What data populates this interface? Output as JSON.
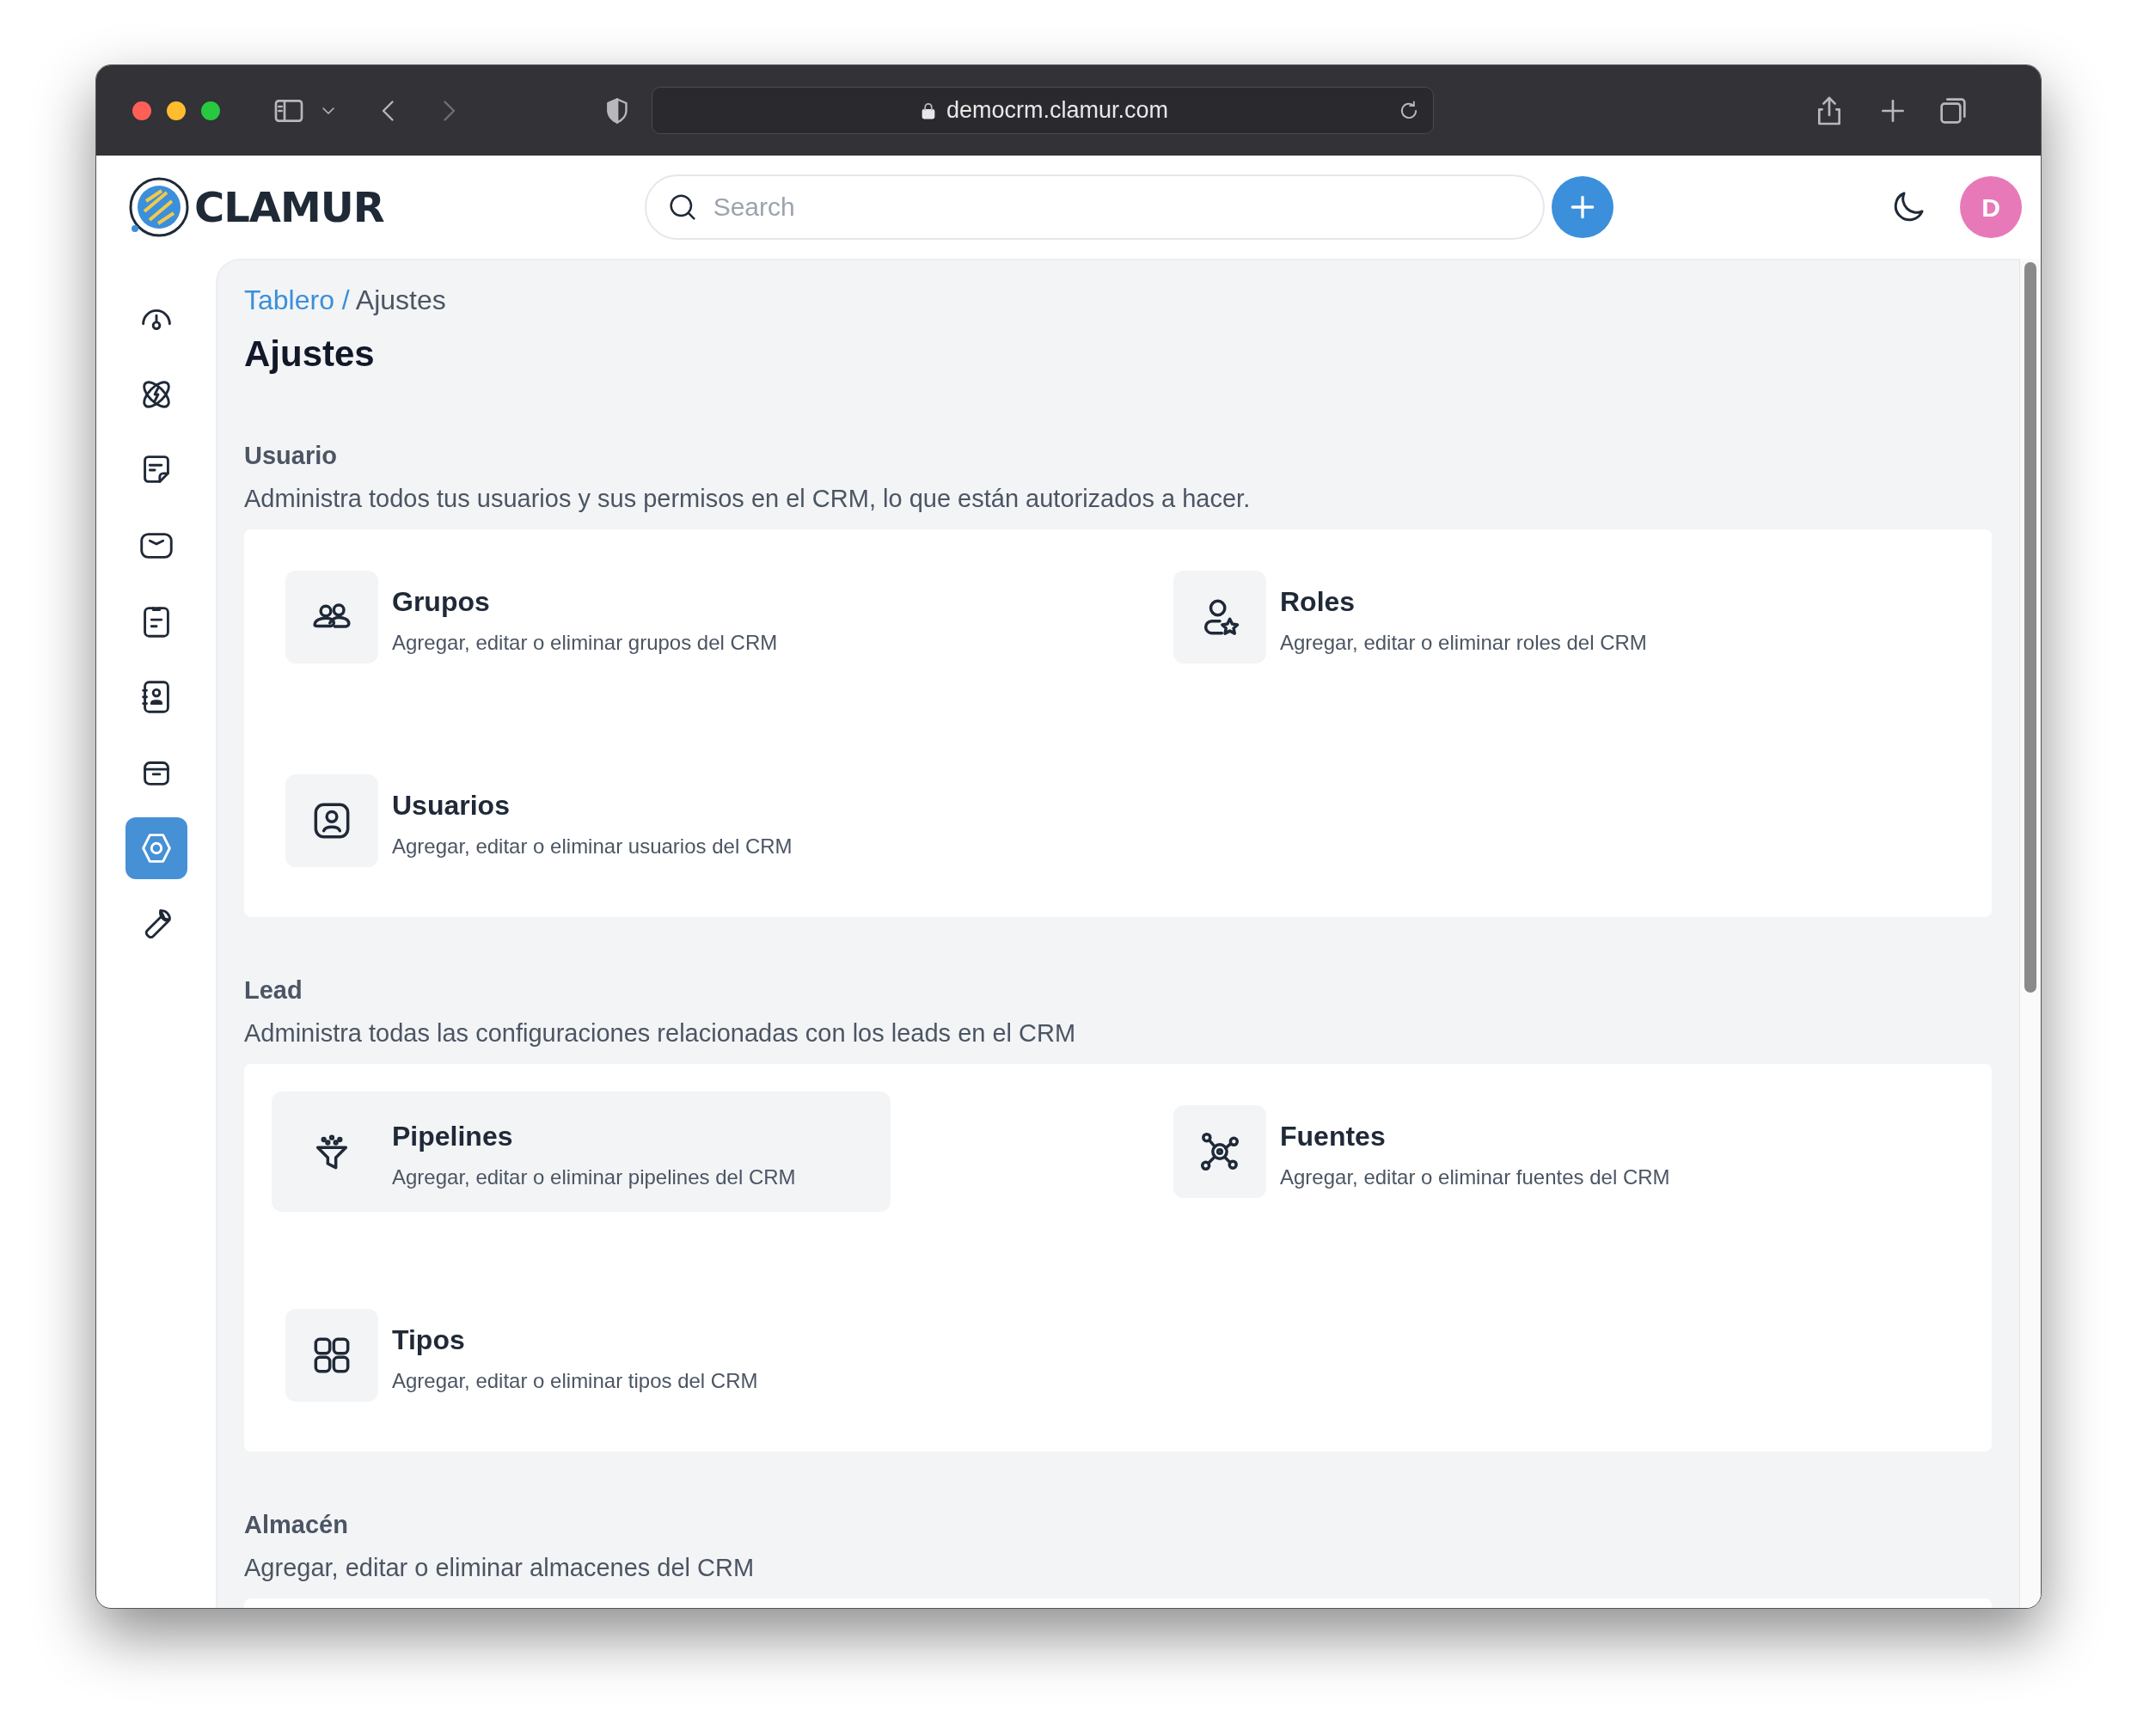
{
  "browser": {
    "url": "democrm.clamur.com"
  },
  "header": {
    "logo": "CLAMUR",
    "search": {
      "placeholder": "Search"
    },
    "avatar": "D"
  },
  "sidebar": {
    "items": [
      {
        "selected": false
      },
      {
        "selected": false
      },
      {
        "selected": false
      },
      {
        "selected": false
      },
      {
        "selected": false
      },
      {
        "selected": false
      },
      {
        "selected": false
      },
      {
        "selected": true
      },
      {
        "selected": false
      }
    ]
  },
  "breadcrumb": {
    "items": [
      {
        "label": "Tablero",
        "link": true
      },
      {
        "label": "Ajustes",
        "link": false
      }
    ],
    "separator": "/"
  },
  "page_title": "Ajustes",
  "sections": [
    {
      "title": "Usuario",
      "description": "Administra todos tus usuarios y sus permisos en el CRM, lo que están autorizados a hacer.",
      "items": [
        {
          "title": "Grupos",
          "description": "Agregar, editar o eliminar grupos del CRM",
          "highlighted": false
        },
        {
          "title": "Roles",
          "description": "Agregar, editar o eliminar roles del CRM",
          "highlighted": false
        },
        {
          "title": "Usuarios",
          "description": "Agregar, editar o eliminar usuarios del CRM",
          "highlighted": false
        }
      ]
    },
    {
      "title": "Lead",
      "description": "Administra todas las configuraciones relacionadas con los leads en el CRM",
      "items": [
        {
          "title": "Pipelines",
          "description": "Agregar, editar o eliminar pipelines del CRM",
          "highlighted": true
        },
        {
          "title": "Fuentes",
          "description": "Agregar, editar o eliminar fuentes del CRM",
          "highlighted": false
        },
        {
          "title": "Tipos",
          "description": "Agregar, editar o eliminar tipos del CRM",
          "highlighted": false
        }
      ]
    },
    {
      "title": "Almacén",
      "description": "Agregar, editar o eliminar almacenes del CRM"
    }
  ]
}
